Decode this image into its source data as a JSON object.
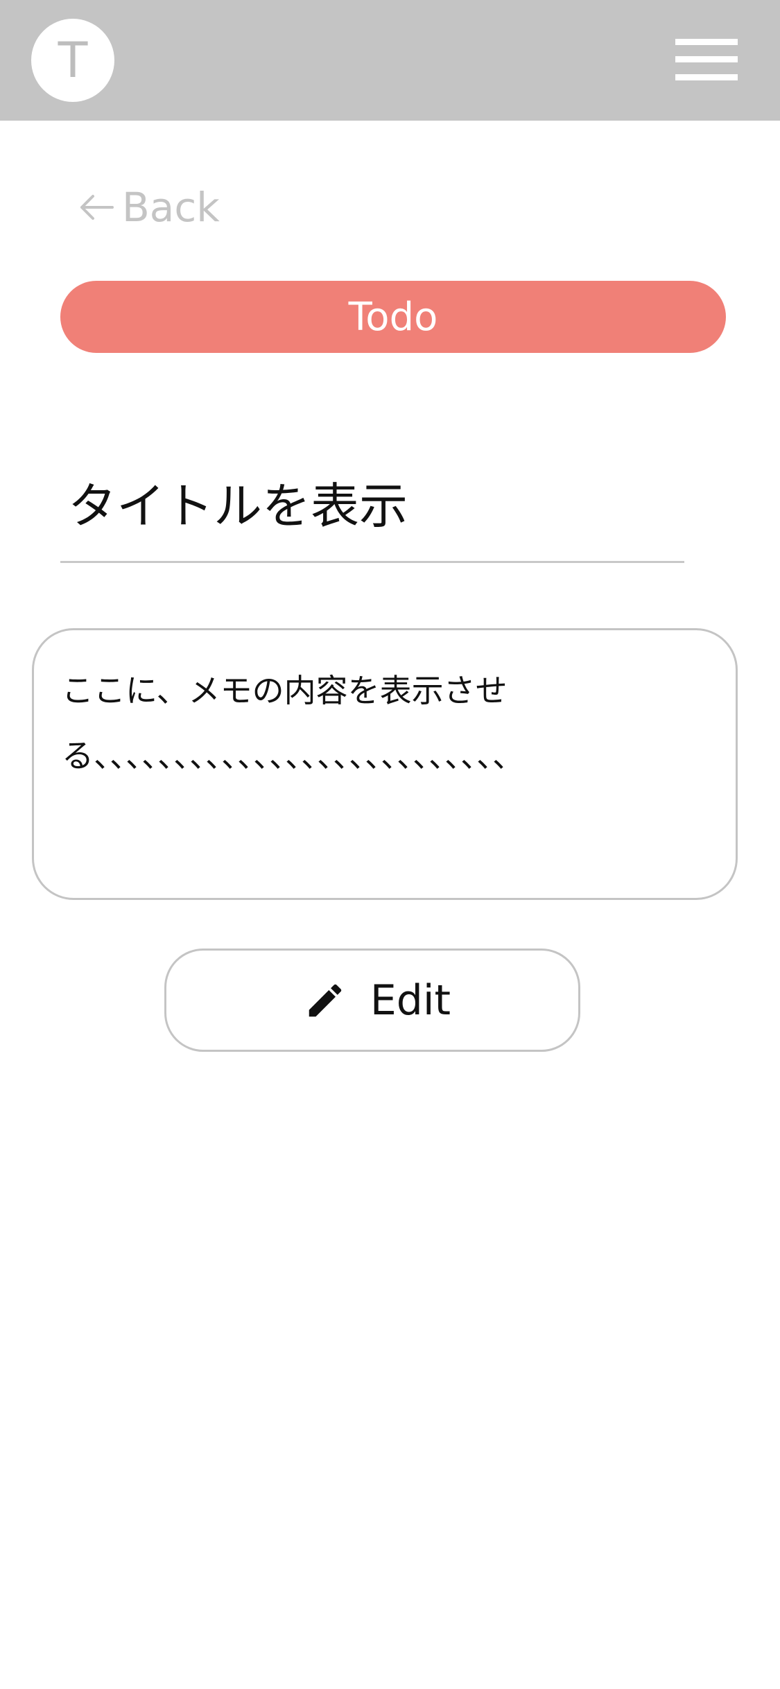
{
  "header": {
    "avatar_letter": "T",
    "menu_icon": "hamburger-menu-icon",
    "background_color": "#c4c4c4"
  },
  "nav": {
    "back_label": "Back",
    "back_icon": "arrow-left-icon"
  },
  "status": {
    "label": "Todo",
    "color": "#f08077"
  },
  "memo": {
    "title": "タイトルを表示",
    "content": "ここに、メモの内容を表示させる、、、、、、、、、、、、、、、、、、、、、、、、、、"
  },
  "actions": {
    "edit_label": "Edit",
    "edit_icon": "pencil-icon"
  }
}
